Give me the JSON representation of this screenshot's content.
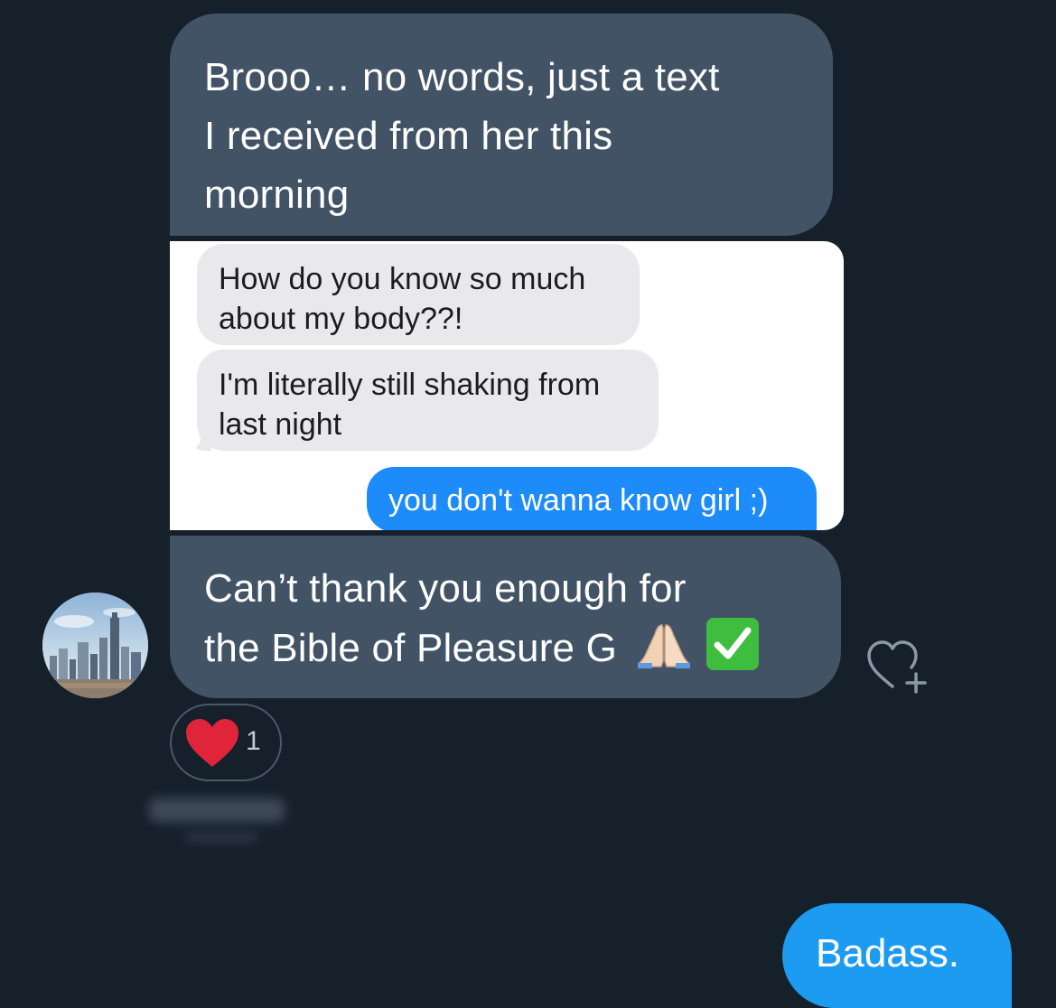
{
  "messages": [
    {
      "id": "msg1",
      "direction": "incoming",
      "lines": [
        "Brooo… no words, just a text",
        "I received from her this",
        "morning"
      ]
    },
    {
      "id": "msg-img",
      "direction": "incoming",
      "type": "image",
      "screenshot": {
        "gray_bubbles": [
          {
            "lines": [
              "How do you know so much",
              "about my body??!"
            ]
          },
          {
            "lines": [
              "I'm literally still shaking from",
              "last night"
            ]
          }
        ],
        "blue_bubble": {
          "text": "you don't wanna know girl ;)"
        }
      }
    },
    {
      "id": "msg2",
      "direction": "incoming",
      "lines": [
        "Can’t thank you enough for",
        "the Bible of Pleasure G"
      ],
      "emojis": [
        "folded-hands-icon",
        "check-mark-button-icon"
      ]
    },
    {
      "id": "msg3",
      "direction": "outgoing",
      "text": "Badass."
    }
  ],
  "reaction": {
    "icon": "heart-icon",
    "count": "1"
  },
  "colors": {
    "background": "#15202b",
    "incoming_bubble": "#435366",
    "outgoing_bubble": "#1d9bf0",
    "imessage_gray": "#e9e9eb",
    "imessage_blue": "#1e8bfb",
    "heart": "#e0243a",
    "check": "#3ebd3e"
  },
  "icons": {
    "avatar": "avatar",
    "add_reaction": "heart-plus-icon"
  }
}
